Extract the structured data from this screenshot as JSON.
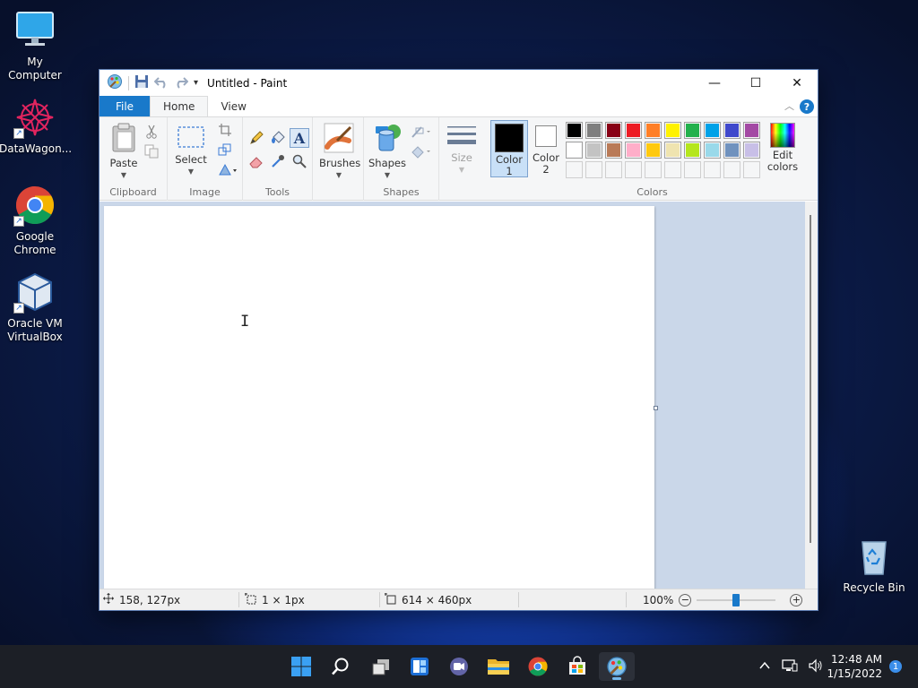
{
  "desktop": {
    "icons": [
      {
        "label": "My Computer"
      },
      {
        "label": "DataWagon..."
      },
      {
        "label": "Google Chrome"
      },
      {
        "label": "Oracle VM VirtualBox"
      },
      {
        "label": "Recycle Bin"
      }
    ]
  },
  "window": {
    "title": "Untitled - Paint",
    "controls": {
      "minimize": "—",
      "maximize": "☐",
      "close": "✕"
    }
  },
  "tabs": [
    {
      "label": "File"
    },
    {
      "label": "Home"
    },
    {
      "label": "View"
    }
  ],
  "ribbon": {
    "clipboard": {
      "paste": "Paste",
      "label": "Clipboard"
    },
    "image": {
      "select": "Select",
      "label": "Image"
    },
    "tools": {
      "label": "Tools"
    },
    "brushes": {
      "label": "Brushes"
    },
    "shapes": {
      "label": "Shapes",
      "shapes_btn": "Shapes"
    },
    "size": {
      "label": "Size"
    },
    "colors": {
      "color1": "Color\n1",
      "color1_line1": "Color",
      "color1_line2": "1",
      "color2_line1": "Color",
      "color2_line2": "2",
      "edit_line1": "Edit",
      "edit_line2": "colors",
      "label": "Colors",
      "color1_value": "#000000",
      "color2_value": "#ffffff",
      "palette_row1": [
        "#000000",
        "#7f7f7f",
        "#880015",
        "#ed1c24",
        "#ff7f27",
        "#fff200",
        "#22b14c",
        "#00a2e8",
        "#3f48cc",
        "#a349a4"
      ],
      "palette_row2": [
        "#ffffff",
        "#c3c3c3",
        "#b97a57",
        "#ffaec9",
        "#ffc90e",
        "#efe4b0",
        "#b5e61d",
        "#99d9ea",
        "#7092be",
        "#c8bfe7"
      ]
    }
  },
  "status": {
    "cursor_pos": "158, 127px",
    "selection_size": "1 × 1px",
    "image_size": "614 × 460px",
    "zoom": "100%"
  },
  "taskbar": {
    "time": "12:48 AM",
    "date": "1/15/2022",
    "notifications": "1",
    "apps": [
      "start-icon",
      "search-icon",
      "task-view-icon",
      "widgets-icon",
      "chat-icon",
      "file-explorer-icon",
      "chrome-icon",
      "store-icon",
      "paint-icon"
    ]
  }
}
